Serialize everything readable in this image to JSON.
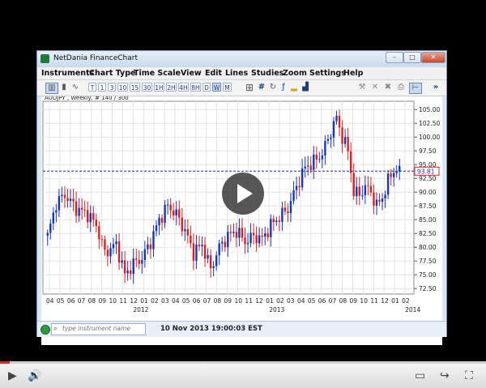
{
  "window": {
    "title": "NetDania FinanceChart",
    "controls": [
      "–",
      "□",
      "✕"
    ]
  },
  "menu": [
    "Instruments",
    "Chart Type",
    "Time Scale",
    "View",
    "Edit",
    "Lines",
    "Studies",
    "Zoom",
    "Settings",
    "Help"
  ],
  "toolbar": {
    "periods": [
      "T",
      "1",
      "3",
      "10",
      "15",
      "30",
      "1H",
      "2H",
      "4H",
      "8H",
      "D",
      "W",
      "M"
    ],
    "selected_period": "W",
    "icons": [
      "bar-chart-type-icon",
      "candlestick-type-icon",
      "line-chart-type-icon",
      "crosshair-icon",
      "grid-icon",
      "zoom-in-icon",
      "drawing-icon",
      "volume-icon",
      "studies-icon",
      "delete-icon",
      "close-chart-icon",
      "delete-all-icon",
      "print-icon",
      "layout-icon",
      "more-icon"
    ]
  },
  "chart": {
    "label": "AUDJPY , Weekly, # 140 / 300",
    "current_price": "93.81",
    "colors": {
      "up": "#1537b8",
      "down": "#d82020",
      "level": "#1b2fa8"
    }
  },
  "chart_data": {
    "type": "candlestick",
    "instrument": "AUDJPY",
    "interval": "Weekly",
    "ylim": [
      71.5,
      106.5
    ],
    "yticks": [
      "105.00",
      "102.50",
      "100.00",
      "97.50",
      "95.00",
      "92.50",
      "90.00",
      "87.50",
      "85.00",
      "82.50",
      "80.00",
      "77.50",
      "75.00",
      "72.50"
    ],
    "xticks": [
      "04",
      "05",
      "06",
      "07",
      "08",
      "09",
      "10",
      "11",
      "12",
      "01",
      "02",
      "03",
      "04",
      "05",
      "06",
      "07",
      "08",
      "09",
      "10",
      "11",
      "12",
      "01",
      "02",
      "03",
      "04",
      "05",
      "06",
      "07",
      "08",
      "09",
      "10",
      "11",
      "12",
      "01",
      "02"
    ],
    "year_labels": [
      "2012",
      "2013",
      "2014"
    ],
    "last_value": 93.81,
    "close_anchors": [
      [
        0,
        82
      ],
      [
        3,
        88
      ],
      [
        6,
        89.5
      ],
      [
        10,
        87
      ],
      [
        14,
        86
      ],
      [
        17,
        84
      ],
      [
        20,
        79
      ],
      [
        24,
        80.5
      ],
      [
        27,
        75
      ],
      [
        30,
        77
      ],
      [
        33,
        78
      ],
      [
        36,
        81
      ],
      [
        39,
        85
      ],
      [
        42,
        87.5
      ],
      [
        45,
        86
      ],
      [
        48,
        83
      ],
      [
        51,
        79
      ],
      [
        54,
        80.5
      ],
      [
        57,
        76
      ],
      [
        60,
        80
      ],
      [
        63,
        82
      ],
      [
        66,
        83
      ],
      [
        69,
        81
      ],
      [
        72,
        82
      ],
      [
        75,
        81.5
      ],
      [
        78,
        84
      ],
      [
        81,
        85.5
      ],
      [
        84,
        87
      ],
      [
        87,
        91
      ],
      [
        90,
        94.5
      ],
      [
        93,
        95.5
      ],
      [
        96,
        97
      ],
      [
        99,
        101
      ],
      [
        101,
        103.5
      ],
      [
        103,
        100
      ],
      [
        105,
        97.5
      ],
      [
        107,
        90
      ],
      [
        109,
        89.5
      ],
      [
        111,
        91
      ],
      [
        113,
        90
      ],
      [
        115,
        87.5
      ],
      [
        117,
        89
      ],
      [
        119,
        92
      ],
      [
        121,
        94
      ],
      [
        123,
        93.8
      ]
    ]
  },
  "status": {
    "search_placeholder": "type instrument name",
    "datetime": "10 Nov 2013 19:00:03 EST"
  },
  "player": {
    "progress_fraction": 0.02
  }
}
